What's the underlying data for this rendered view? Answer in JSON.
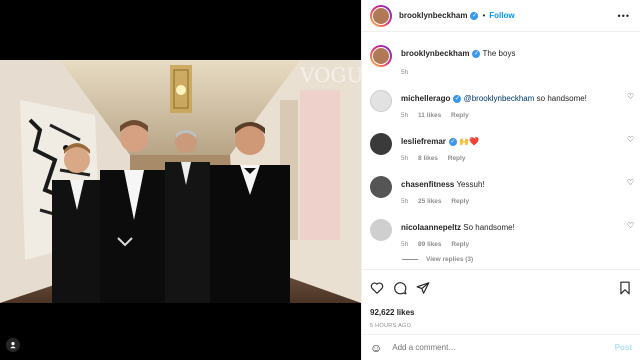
{
  "post": {
    "username": "brooklynbeckham",
    "follow_label": "Follow",
    "more_label": "•••",
    "caption_username": "brooklynbeckham",
    "caption": "The boys",
    "caption_time": "5h",
    "magazine_mark": "VOGUE"
  },
  "comments": [
    {
      "username": "michellerago",
      "mention": "@brooklynbeckham",
      "text": " so handsome!",
      "time": "5h",
      "likes": "11 likes",
      "reply": "Reply",
      "avatar_color": "#d8d8d8"
    },
    {
      "username": "lesliefremar",
      "mention": "",
      "text": "🙌❤️",
      "time": "5h",
      "likes": "8 likes",
      "reply": "Reply",
      "avatar_color": "#3a3a3a"
    },
    {
      "username": "chasenfitness",
      "mention": "",
      "text": "Yessuh!",
      "time": "5h",
      "likes": "25 likes",
      "reply": "Reply",
      "avatar_color": "#555555"
    },
    {
      "username": "nicolaannepeltz",
      "mention": "",
      "text": "So handsome!",
      "time": "5h",
      "likes": "89 likes",
      "reply": "Reply",
      "avatar_color": "#c9c9c9"
    }
  ],
  "view_replies": "View replies (3)",
  "actions": {
    "likes": "92,622 likes",
    "ago": "5 HOURS AGO"
  },
  "add_comment": {
    "placeholder": "Add a comment…",
    "post_label": "Post"
  },
  "colors": {
    "link_blue": "#0095f6",
    "verified_blue": "#3897f0",
    "muted": "#8e8e8e"
  }
}
